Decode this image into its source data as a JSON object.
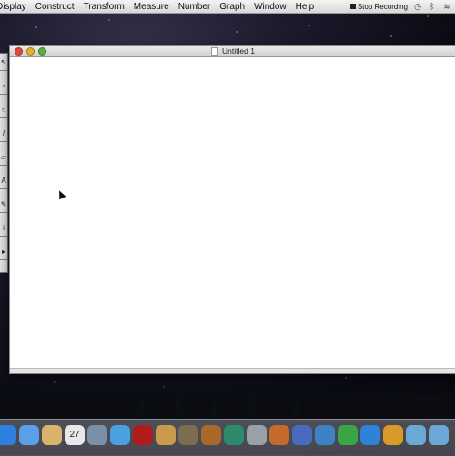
{
  "menubar": {
    "items": [
      "Display",
      "Construct",
      "Transform",
      "Measure",
      "Number",
      "Graph",
      "Window",
      "Help"
    ],
    "recording_label": "Stop Recording"
  },
  "window": {
    "title": "Untitled 1"
  },
  "palette": {
    "tools": [
      {
        "icon": "arrow-icon"
      },
      {
        "icon": "point-icon"
      },
      {
        "icon": "compass-icon"
      },
      {
        "icon": "straightedge-icon"
      },
      {
        "icon": "polygon-icon"
      },
      {
        "icon": "text-icon"
      },
      {
        "icon": "marker-icon"
      },
      {
        "icon": "info-icon"
      },
      {
        "icon": "custom-tool-icon"
      }
    ]
  },
  "dock": {
    "icons": [
      {
        "name": "finder-icon",
        "color": "#2d7fe0"
      },
      {
        "name": "facetime-icon",
        "color": "#5aa0e8"
      },
      {
        "name": "notes-icon",
        "color": "#d8b46a"
      },
      {
        "name": "calendar-icon",
        "color": "#e8e8e8",
        "label": "27"
      },
      {
        "name": "preview-icon",
        "color": "#7b8fa8"
      },
      {
        "name": "itunes-icon",
        "color": "#4aa0e0"
      },
      {
        "name": "photo-booth-icon",
        "color": "#b01b1b"
      },
      {
        "name": "iphoto-icon",
        "color": "#c89a4c"
      },
      {
        "name": "imovie-icon",
        "color": "#7a6e4e"
      },
      {
        "name": "garageband-icon",
        "color": "#a86a2a"
      },
      {
        "name": "time-machine-icon",
        "color": "#2d8a6a"
      },
      {
        "name": "screenshot-icon",
        "color": "#9aa0a8"
      },
      {
        "name": "keynote-icon",
        "color": "#c46a2a"
      },
      {
        "name": "xcode-icon",
        "color": "#4a6ac0"
      },
      {
        "name": "sketchpad-icon",
        "color": "#3e82c6"
      },
      {
        "name": "chrome-icon",
        "color": "#3aa545"
      },
      {
        "name": "safari-icon",
        "color": "#2f82d6"
      },
      {
        "name": "migration-icon",
        "color": "#d99a2a"
      },
      {
        "name": "folder-icon",
        "color": "#6aa8d8"
      },
      {
        "name": "downloads-icon",
        "color": "#6aa8d8"
      }
    ]
  }
}
